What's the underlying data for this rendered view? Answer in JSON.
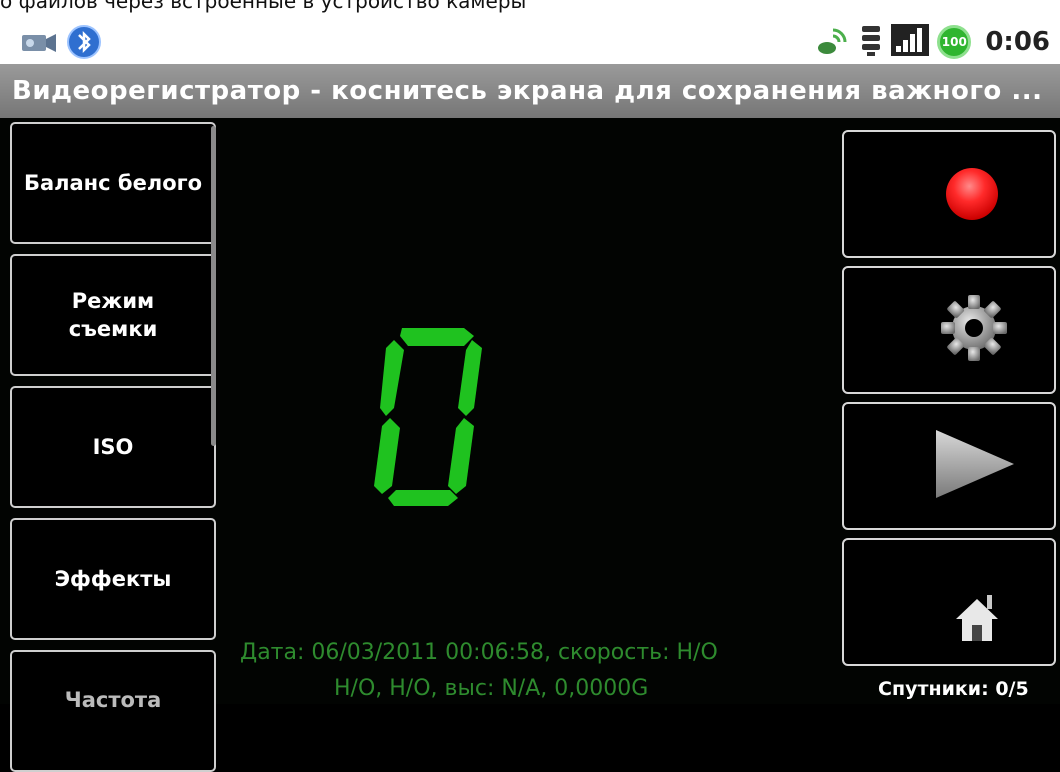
{
  "caption": {
    "text": "о файлов через встроенные в устройство камеры"
  },
  "status_bar": {
    "left_icons": [
      "camera-recorder-icon",
      "bluetooth-globe-icon"
    ],
    "right_icons": [
      "gps-signal-icon",
      "wifi-icon",
      "cell-signal-icon",
      "battery-icon"
    ],
    "battery_level": "100",
    "time": "0:06",
    "colors": {
      "background": "#ffffff",
      "battery": "#2fb52f"
    }
  },
  "title_bar": {
    "title": "Видеорегистратор - коснитесь экрана для сохранения важного ..."
  },
  "left_menu": {
    "items": [
      {
        "label": "Баланс белого"
      },
      {
        "label": "Режим съемки"
      },
      {
        "label": "ISO"
      },
      {
        "label": "Эффекты"
      },
      {
        "label": "Частота"
      }
    ]
  },
  "right_menu": {
    "buttons": [
      {
        "icon": "record-icon"
      },
      {
        "icon": "gear-icon"
      },
      {
        "icon": "play-icon"
      },
      {
        "icon": "home-icon"
      }
    ]
  },
  "counter": {
    "value": "0",
    "color": "#1fc21f"
  },
  "info": {
    "line1": "Дата: 06/03/2011 00:06:58, скорость: Н/О",
    "line2": "Н/О, Н/О, выс: N/A, 0,0000G",
    "color": "#2e8b2e"
  },
  "satellites": {
    "label": "Спутники: 0/5"
  }
}
